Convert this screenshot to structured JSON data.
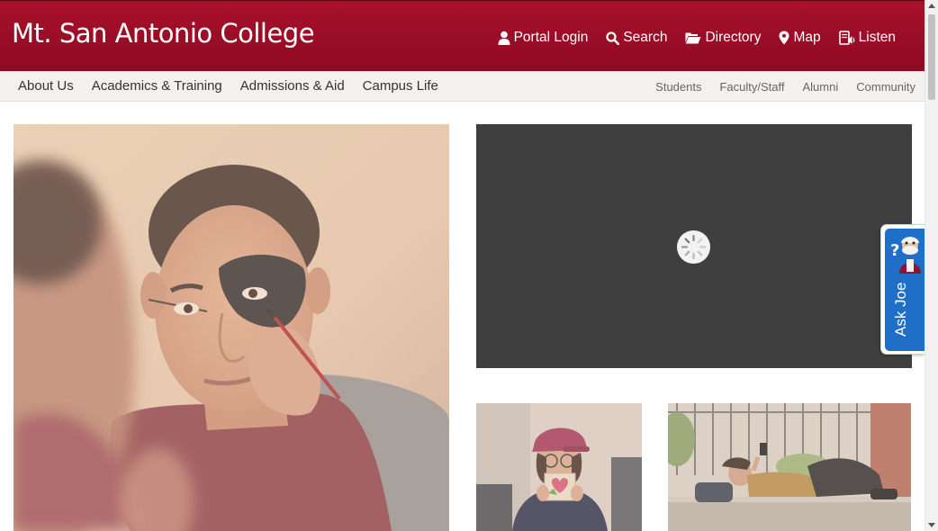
{
  "header": {
    "logo_text": "Mt. San Antonio College",
    "brand_color": "#9b0c26",
    "utility_links": [
      {
        "label": "Portal Login",
        "icon": "user-icon"
      },
      {
        "label": "Search",
        "icon": "search-icon"
      },
      {
        "label": "Directory",
        "icon": "folder-open-icon"
      },
      {
        "label": "Map",
        "icon": "map-marker-icon"
      },
      {
        "label": "Listen",
        "icon": "listen-icon"
      }
    ]
  },
  "main_nav": {
    "items": [
      "About Us",
      "Academics & Training",
      "Admissions & Aid",
      "Campus Life"
    ]
  },
  "audience_nav": {
    "items": [
      "Students",
      "Faculty/Staff",
      "Alumni",
      "Community"
    ]
  },
  "media": {
    "hero_image": "student-face-painting-photo",
    "video_player": "loading-spinner",
    "thumb1": "student-holding-heart-photo",
    "thumb2": "student-lying-on-bench-photo"
  },
  "chat_widget": {
    "label": "Ask Joe",
    "icon": "mascot-icon",
    "color": "#1f6fc9"
  }
}
